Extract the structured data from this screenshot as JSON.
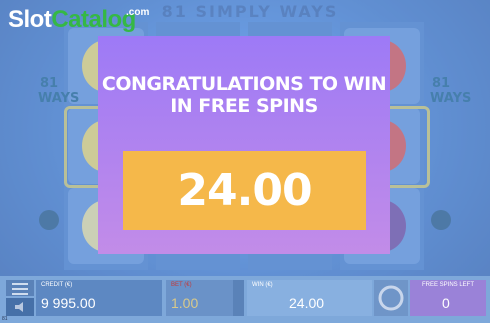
{
  "branding": {
    "logo_part1": "Slot",
    "logo_part2": "Catalog",
    "logo_suffix": ".com",
    "colors": {
      "slot": "#ffffff",
      "catalog": "#35b845"
    }
  },
  "game": {
    "title": "81 SIMPLY WAYS",
    "side_label_left": "81\nWAYS",
    "side_label_right": "81\nWAYS"
  },
  "popup": {
    "title_line1": "CONGRATULATIONS TO WIN",
    "title_line2": "IN FREE SPINS",
    "amount": "24.00",
    "colors": {
      "bg_top": "#9d7af6",
      "bg_bottom": "#c28ce8",
      "amount_box": "#f5b84a"
    }
  },
  "bottom_bar": {
    "credit_label": "CREDIT (€)",
    "credit_value": "9 995.00",
    "bet_label": "BET (€)",
    "bet_value": "1.00",
    "win_label": "WIN (€)",
    "win_value": "24.00",
    "free_spins_label": "FREE SPINS LEFT",
    "free_spins_value": "0",
    "footer": "81"
  }
}
